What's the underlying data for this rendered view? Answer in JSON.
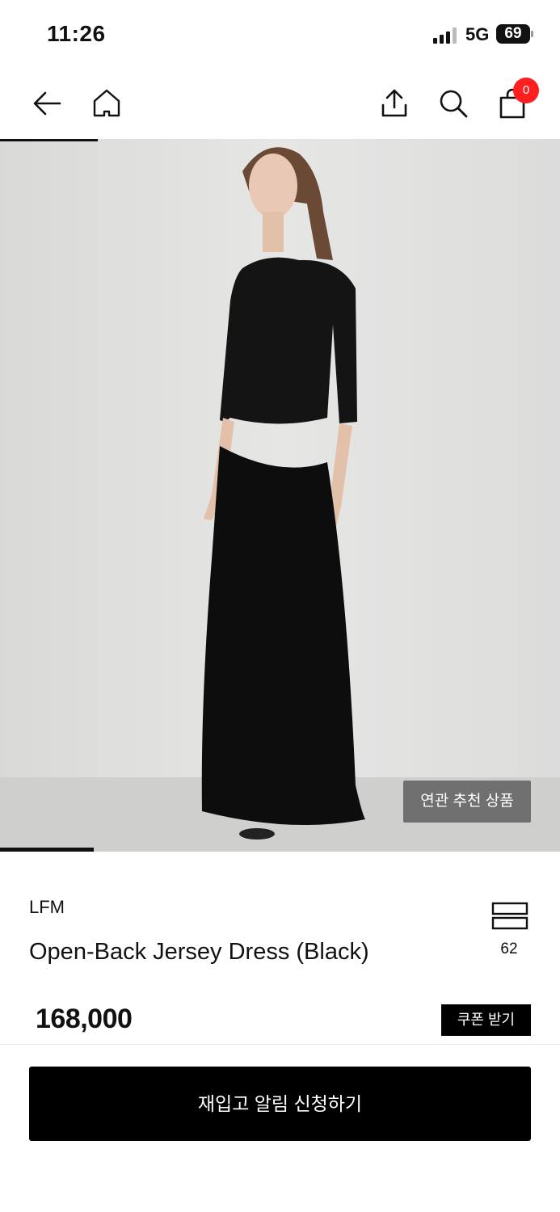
{
  "status_bar": {
    "time": "11:26",
    "network": "5G",
    "battery": "69"
  },
  "nav": {
    "back_icon": "arrow-left-icon",
    "home_icon": "home-icon",
    "share_icon": "share-icon",
    "search_icon": "search-icon",
    "cart_icon": "shopping-bag-icon",
    "cart_count": "0"
  },
  "gallery": {
    "related_label": "연관 추천 상품"
  },
  "product": {
    "brand": "LFM",
    "name": "Open-Back Jersey Dress (Black)",
    "like_count": "62",
    "price": "168,000",
    "coupon_label": "쿠폰 받기"
  },
  "cta": {
    "restock_label": "재입고 알림 신청하기"
  },
  "colors": {
    "badge": "#ff1f1f",
    "primary": "#000000"
  }
}
